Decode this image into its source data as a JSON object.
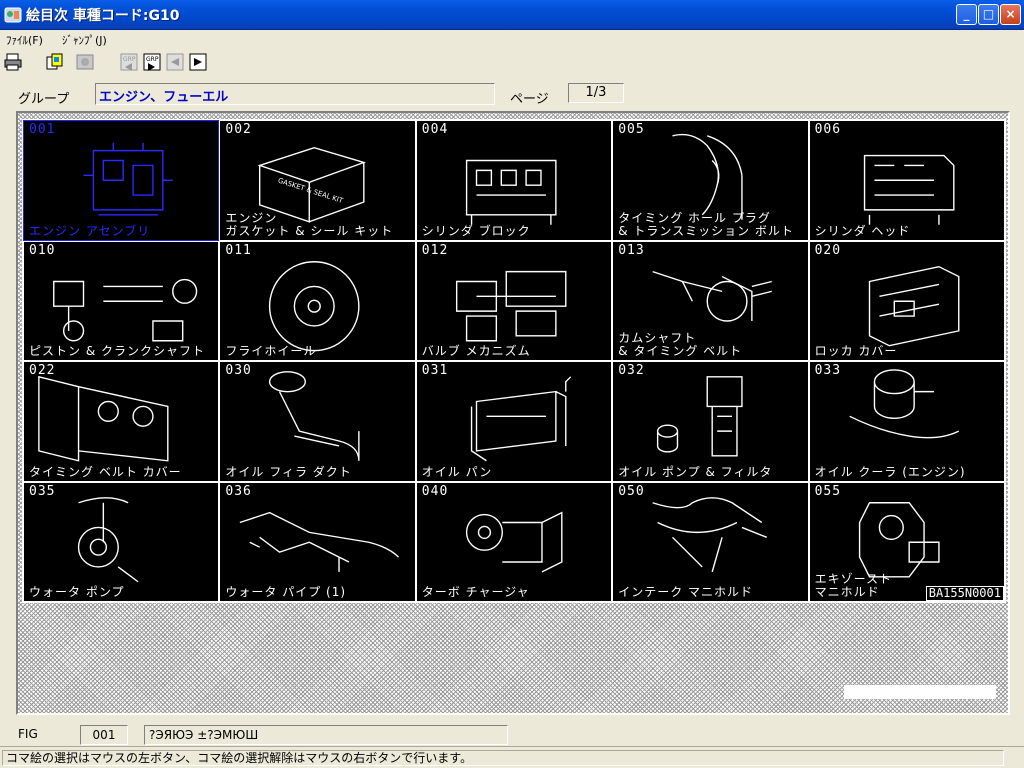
{
  "window": {
    "title": "絵目次 車種コード:G10",
    "buttons": {
      "minimize": "_",
      "maximize": "□",
      "close": "×"
    }
  },
  "menu": [
    "ﾌｧｲﾙ(F)",
    "ｼﾞｬﾝﾌﾟ(J)"
  ],
  "toolbar": {
    "icons": [
      "printer-icon",
      "copy-picture-icon",
      "disabled-picture-icon",
      "grp-prev-icon",
      "grp-next-icon",
      "page-prev-icon",
      "page-next-icon"
    ]
  },
  "group": {
    "label": "グループ",
    "value": "エンジン、フューエル"
  },
  "page": {
    "label": "ページ",
    "value": "1/3"
  },
  "figures": [
    {
      "num": "001",
      "caption": "エンジン アセンブリ",
      "selected": true
    },
    {
      "num": "002",
      "caption": "エンジン\nガスケット & シール キット"
    },
    {
      "num": "004",
      "caption": "シリンダ ブロック"
    },
    {
      "num": "005",
      "caption": "タイミング ホール プラグ\n& トランスミッション ボルト"
    },
    {
      "num": "006",
      "caption": "シリンダ ヘッド"
    },
    {
      "num": "010",
      "caption": "ピストン & クランクシャフト"
    },
    {
      "num": "011",
      "caption": "フライホイール"
    },
    {
      "num": "012",
      "caption": "バルブ メカニズム"
    },
    {
      "num": "013",
      "caption": "カムシャフト\n& タイミング ベルト"
    },
    {
      "num": "020",
      "caption": "ロッカ カバー"
    },
    {
      "num": "022",
      "caption": "タイミング ベルト カバー"
    },
    {
      "num": "030",
      "caption": "オイル フィラ ダクト"
    },
    {
      "num": "031",
      "caption": "オイル パン"
    },
    {
      "num": "032",
      "caption": "オイル ポンプ & フィルタ"
    },
    {
      "num": "033",
      "caption": "オイル クーラ (エンジン)"
    },
    {
      "num": "035",
      "caption": "ウォータ ポンプ"
    },
    {
      "num": "036",
      "caption": "ウォータ パイプ (1)"
    },
    {
      "num": "040",
      "caption": "ターボ チャージャ"
    },
    {
      "num": "050",
      "caption": "インテーク マニホルド"
    },
    {
      "num": "055",
      "caption": "エキゾースト\nマニホルド"
    }
  ],
  "picture_id": "BA155N0001",
  "gasket_box_text": "GASKET & SEAL KIT",
  "fig": {
    "label": "FIG",
    "value": "001",
    "description": "?ЭЯЮЭ ±?ЭМЮШ"
  },
  "status": "コマ絵の選択はマウスの左ボタン、コマ絵の選択解除はマウスの右ボタンで行います。",
  "colors": {
    "title_bar": "#0250d8",
    "selected": "#2a2aff",
    "group_text": "#0000c8",
    "grid_bg": "#000000"
  }
}
